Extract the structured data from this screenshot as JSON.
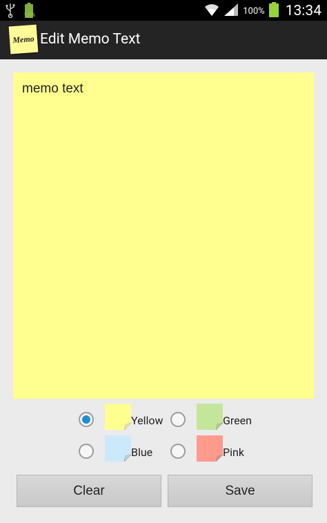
{
  "status_bar": {
    "small_battery_label": "100%",
    "battery_percent": "100%",
    "time": "13:34"
  },
  "action_bar": {
    "icon_text": "Memo",
    "title": "Edit Memo Text"
  },
  "memo": {
    "text": "memo text",
    "background": "#ffff8f"
  },
  "color_options": [
    {
      "label": "Yellow",
      "color": "#ffff8f",
      "selected": true
    },
    {
      "label": "Green",
      "color": "#c3e69a",
      "selected": false
    },
    {
      "label": "Blue",
      "color": "#cbe9fb",
      "selected": false
    },
    {
      "label": "Pink",
      "color": "#ff9a8d",
      "selected": false
    }
  ],
  "buttons": {
    "clear_label": "Clear",
    "save_label": "Save"
  },
  "colors": {
    "accent": "#1f8fcf",
    "action_bar": "#242424",
    "status_bar": "#000000"
  }
}
